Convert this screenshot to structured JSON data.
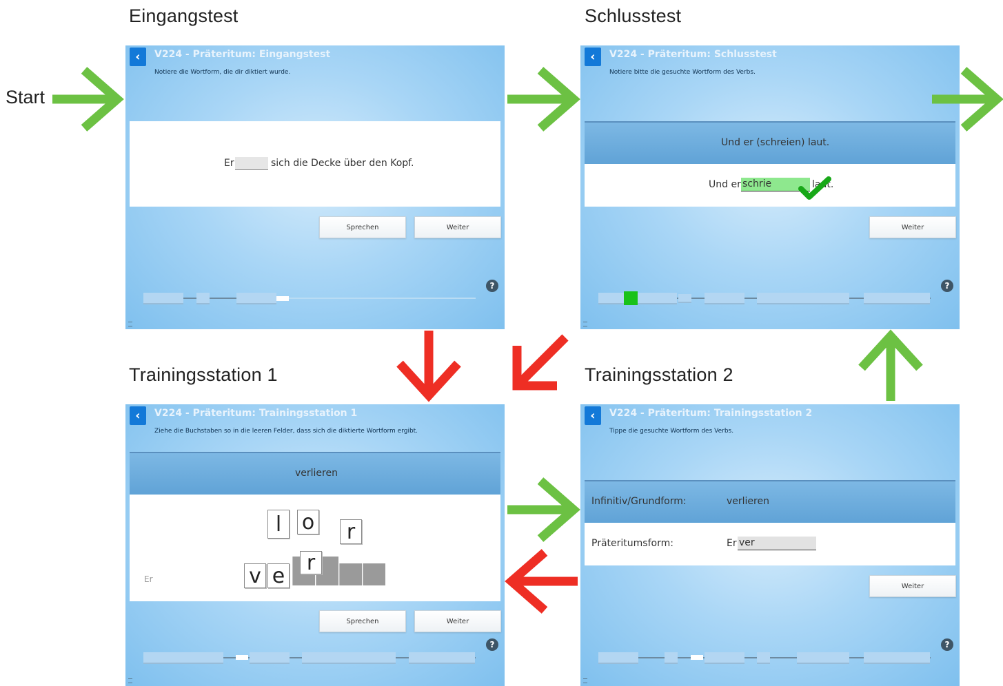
{
  "captions": {
    "start": "Start",
    "eingangstest": "Eingangstest",
    "schlusstest": "Schlusstest",
    "training1": "Trainingsstation 1",
    "training2": "Trainingsstation 2"
  },
  "screens": {
    "eingangstest": {
      "title": "V224 - Präteritum: Eingangstest",
      "instruction": "Notiere die Wortform, die dir diktiert wurde.",
      "sentence_before": "Er",
      "sentence_after": "sich die Decke über den Kopf.",
      "buttons": {
        "speak": "Sprechen",
        "next": "Weiter"
      },
      "help": "?"
    },
    "schlusstest": {
      "title": "V224 - Präteritum: Schlusstest",
      "instruction": "Notiere bitte die gesuchte Wortform des Verbs.",
      "prompt": "Und er (schreien) laut.",
      "answer_before": "Und er",
      "answer_value": "schrie",
      "answer_after": "laut.",
      "buttons": {
        "next": "Weiter"
      },
      "help": "?"
    },
    "training1": {
      "title": "V224 - Präteritum: Trainingsstation 1",
      "instruction": "Ziehe die Buchstaben so in die leeren Felder, dass sich die diktierte Wortform ergibt.",
      "infinitive": "verlieren",
      "pronoun": "Er",
      "loose_letters": [
        "l",
        "o",
        "r"
      ],
      "dragging_letter": "r",
      "placed_letters": [
        "v",
        "e"
      ],
      "buttons": {
        "speak": "Sprechen",
        "next": "Weiter"
      },
      "help": "?"
    },
    "training2": {
      "title": "V224 - Präteritum: Trainingsstation 2",
      "instruction": "Tippe die gesuchte Wortform des Verbs.",
      "infinitive_label": "Infinitiv/Grundform:",
      "infinitive_value": "verlieren",
      "preterite_label": "Präteritumsform:",
      "preterite_prefix": "Er",
      "preterite_value": "ver",
      "buttons": {
        "next": "Weiter"
      },
      "help": "?"
    }
  },
  "colors": {
    "flow_forward": "#6cc143",
    "flow_back": "#ee2e24",
    "back_button": "#1379d8",
    "correct": "#19c219"
  }
}
